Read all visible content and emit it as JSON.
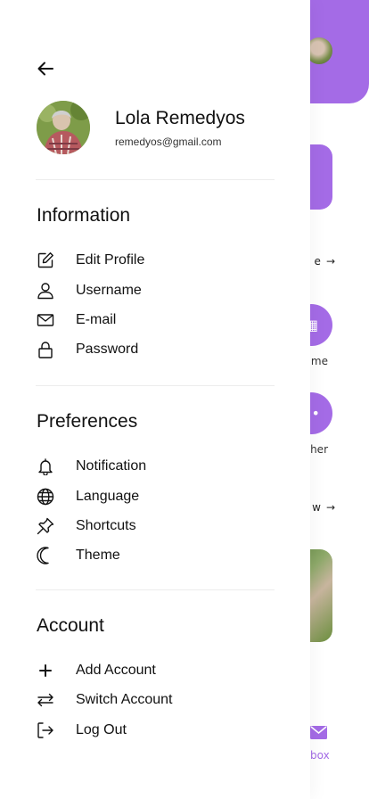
{
  "profile": {
    "name": "Lola Remedyos",
    "email": "remedyos@gmail.com"
  },
  "sections": {
    "information": {
      "title": "Information",
      "items": [
        "Edit Profile",
        "Username",
        "E-mail",
        "Password"
      ]
    },
    "preferences": {
      "title": "Preferences",
      "items": [
        "Notification",
        "Language",
        "Shortcuts",
        "Theme"
      ]
    },
    "account": {
      "title": "Account",
      "items": [
        "Add Account",
        "Switch Account",
        "Log Out"
      ]
    }
  },
  "background": {
    "link_1": "e",
    "circle_1_caption": "me",
    "circle_2_caption": "her",
    "link_2": "w",
    "inbox_label": "box"
  },
  "colors": {
    "accent": "#a46be6",
    "text": "#111111",
    "divider": "#ececec"
  },
  "icons": {
    "back": "arrow-left-icon",
    "edit_profile": "edit-icon",
    "username": "user-icon",
    "email": "mail-icon",
    "password": "lock-icon",
    "notification": "bell-icon",
    "language": "globe-icon",
    "shortcuts": "pin-icon",
    "theme": "moon-icon",
    "add_account": "plus-icon",
    "switch_account": "swap-arrows-icon",
    "log_out": "logout-icon"
  }
}
